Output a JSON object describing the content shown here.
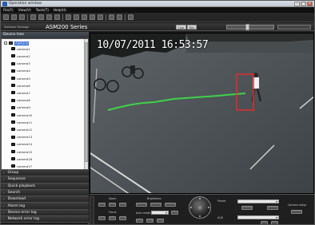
{
  "window": {
    "title": "Operation window",
    "controls": {
      "minimize": "–",
      "maximize": "□",
      "close": "✕"
    }
  },
  "menu": [
    {
      "label": "File(F)"
    },
    {
      "label": "View(V)"
    },
    {
      "label": "Tools(T)"
    },
    {
      "label": "Help(H)"
    }
  ],
  "toolbar": {
    "buttons": [
      "▪",
      "▪",
      "▪",
      "▪",
      "▪",
      "▪",
      "▪",
      "▪",
      "▪",
      "▪",
      "▪",
      "▪",
      "▪",
      "▪",
      "▪",
      "▪",
      "▪",
      "▪"
    ]
  },
  "header": {
    "brand_small": "Software Package",
    "series": "ASM200 Series",
    "btn_a": "Live",
    "btn_b": "Rec"
  },
  "device_tree": {
    "header": "Device tree",
    "root": "ASM200",
    "cameras": [
      "camera1",
      "camera2",
      "camera3",
      "camera4",
      "camera5",
      "camera6",
      "camera7",
      "camera8",
      "camera9",
      "camera10",
      "camera11",
      "camera12",
      "camera13",
      "camera14",
      "camera15",
      "camera16",
      "camera17"
    ]
  },
  "nav": [
    {
      "label": "Group"
    },
    {
      "label": "Sequence"
    },
    {
      "label": "Quick playback"
    },
    {
      "label": "Search"
    },
    {
      "label": "Download"
    },
    {
      "label": "Alarm log"
    },
    {
      "label": "Device error log"
    },
    {
      "label": "Network error log"
    }
  ],
  "video": {
    "timestamp": "10/07/2011  16:53:57"
  },
  "controls": {
    "zoom": "Zoom",
    "focus": "Focus",
    "brightness": "Brightness",
    "auto_mode": "Auto mode",
    "preset": "Preset",
    "aux": "AUX",
    "camera_setup": "Camera setup"
  }
}
